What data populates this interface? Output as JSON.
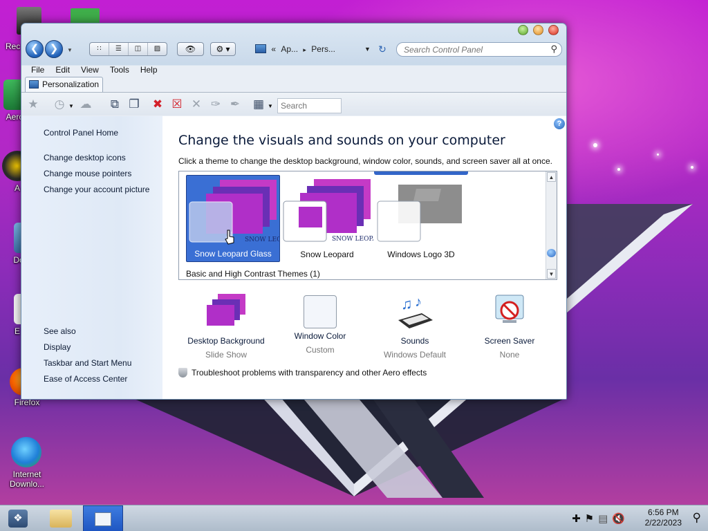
{
  "desktop": {
    "icons": [
      {
        "label": "Rec"
      },
      {
        "label": "Aero P"
      },
      {
        "label": "A"
      },
      {
        "label": "Do"
      },
      {
        "label": "E"
      },
      {
        "label": "Firefox"
      },
      {
        "label": "Internet Downlo..."
      }
    ]
  },
  "window": {
    "title": "Personalization",
    "nav": {
      "address_prefix": "«",
      "address_parts": [
        "Ap...",
        "Pers..."
      ],
      "search_placeholder": "Search Control Panel"
    },
    "menu": [
      "File",
      "Edit",
      "View",
      "Tools",
      "Help"
    ],
    "tab_label": "Personalization",
    "toolbar": {
      "search_placeholder": "Search"
    }
  },
  "left_pane": {
    "home": "Control Panel Home",
    "links": [
      "Change desktop icons",
      "Change mouse pointers",
      "Change your account picture"
    ],
    "see_also": "See also",
    "see_also_links": [
      "Display",
      "Taskbar and Start Menu",
      "Ease of Access Center"
    ]
  },
  "main": {
    "heading": "Change the visuals and sounds on your computer",
    "subheading": "Click a theme to change the desktop background, window color, sounds, and screen saver all at once.",
    "themes": [
      {
        "name": "Snow Leopard Glass",
        "selected": true
      },
      {
        "name": "Snow Leopard",
        "selected": false
      },
      {
        "name": "Windows Logo 3D",
        "selected": false
      }
    ],
    "group_label": "Basic and High Contrast Themes (1)",
    "bottom_items": [
      {
        "title": "Desktop Background",
        "value": "Slide Show",
        "icon": "desktop-background-icon"
      },
      {
        "title": "Window Color",
        "value": "Custom",
        "icon": "window-color-icon"
      },
      {
        "title": "Sounds",
        "value": "Windows Default",
        "icon": "sounds-icon"
      },
      {
        "title": "Screen Saver",
        "value": "None",
        "icon": "screen-saver-icon"
      }
    ],
    "troubleshoot": "Troubleshoot problems with transparency and other Aero effects"
  },
  "taskbar": {
    "time": "6:56 PM",
    "date": "2/22/2023"
  },
  "colors": {
    "accent": "#3a6fd4",
    "wallpaper": "#b62fc5"
  }
}
